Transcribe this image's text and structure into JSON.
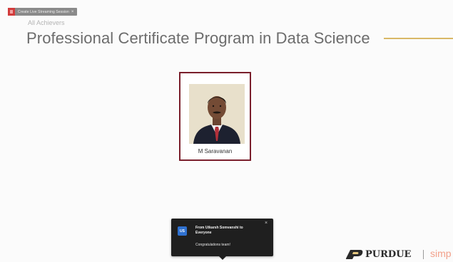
{
  "tab": {
    "label": "Create Live Streaming Session",
    "close_icon": "x-icon"
  },
  "header": {
    "breadcrumb": "All Achievers",
    "title": "Professional Certificate Program in Data Science",
    "rule_color": "#d9b866"
  },
  "achiever": {
    "name": "M Saravanan",
    "border_color": "#7a1f2c"
  },
  "toast": {
    "avatar_initials": "US",
    "from_line": "From Utkarsh Somvanshi to Everyone",
    "message": "Congratulations team!",
    "close_icon": "x-icon"
  },
  "footer": {
    "purdue_label": "PURDUE",
    "separator": "|",
    "partner_label": "simp"
  }
}
